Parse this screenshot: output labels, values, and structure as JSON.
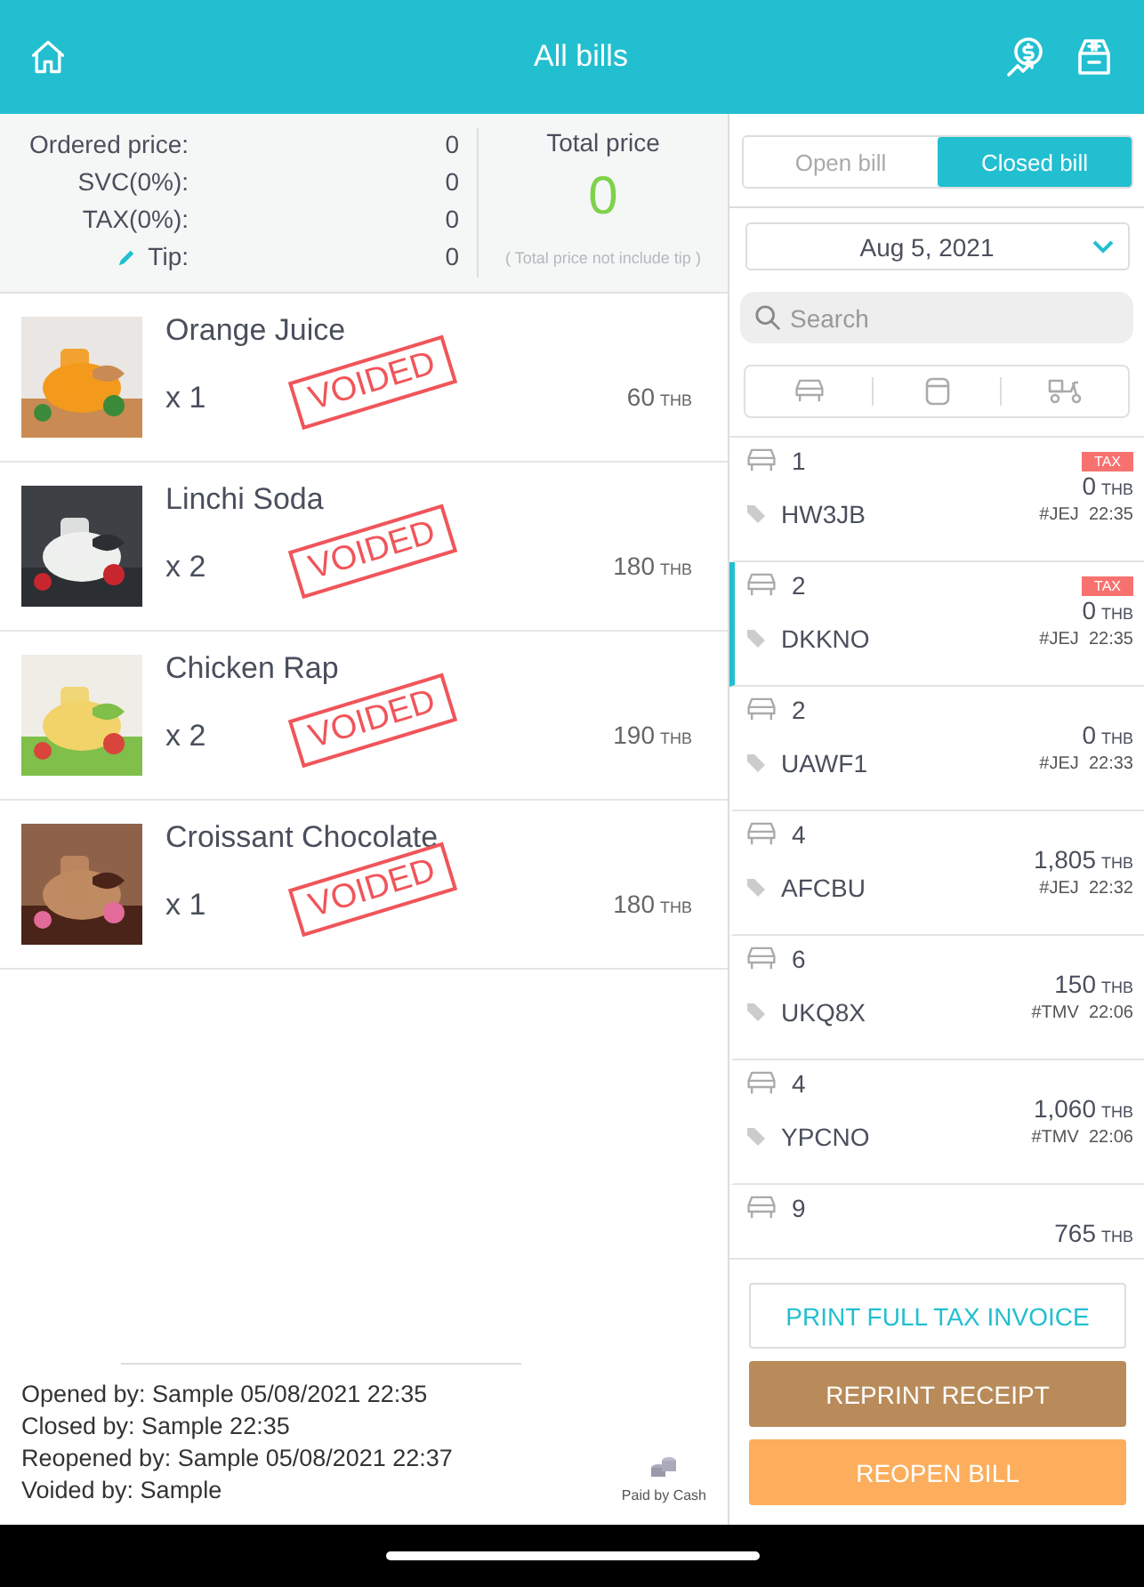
{
  "header": {
    "title": "All bills"
  },
  "summary": {
    "rows": [
      {
        "label": "Ordered price:",
        "value": "0",
        "editable": false
      },
      {
        "label": "SVC(0%):",
        "value": "0",
        "editable": false
      },
      {
        "label": "TAX(0%):",
        "value": "0",
        "editable": false
      },
      {
        "label": "Tip:",
        "value": "0",
        "editable": true
      }
    ],
    "total_label": "Total price",
    "total": "0",
    "total_note": "( Total price not include tip )"
  },
  "items": [
    {
      "name": "Orange Juice",
      "qty": "x 1",
      "price": "60",
      "currency": "THB",
      "stamp": "VOIDED"
    },
    {
      "name": "Linchi Soda",
      "qty": "x 2",
      "price": "180",
      "currency": "THB",
      "stamp": "VOIDED"
    },
    {
      "name": "Chicken Rap",
      "qty": "x 2",
      "price": "190",
      "currency": "THB",
      "stamp": "VOIDED"
    },
    {
      "name": "Croissant Chocolate",
      "qty": "x 1",
      "price": "180",
      "currency": "THB",
      "stamp": "VOIDED"
    }
  ],
  "log": [
    "Opened by: Sample 05/08/2021 22:35",
    "Closed by: Sample 22:35",
    "Reopened by: Sample 05/08/2021 22:37",
    "Voided by: Sample"
  ],
  "payment": "Paid by Cash",
  "tabs": [
    {
      "label": "Open bill",
      "selected": false
    },
    {
      "label": "Closed bill",
      "selected": true
    }
  ],
  "date": "Aug 5, 2021",
  "search": {
    "placeholder": "Search"
  },
  "bills": [
    {
      "table": "1",
      "tax": "TAX",
      "amount": "0",
      "currency": "THB",
      "code": "HW3JB",
      "tag": "#JEJ",
      "time": "22:35",
      "selected": false
    },
    {
      "table": "2",
      "tax": "TAX",
      "amount": "0",
      "currency": "THB",
      "code": "DKKNO",
      "tag": "#JEJ",
      "time": "22:35",
      "selected": true
    },
    {
      "table": "2",
      "amount": "0",
      "currency": "THB",
      "code": "UAWF1",
      "tag": "#JEJ",
      "time": "22:33",
      "selected": false
    },
    {
      "table": "4",
      "amount": "1,805",
      "currency": "THB",
      "code": "AFCBU",
      "tag": "#JEJ",
      "time": "22:32",
      "selected": false
    },
    {
      "table": "6",
      "amount": "150",
      "currency": "THB",
      "code": "UKQ8X",
      "tag": "#TMV",
      "time": "22:06",
      "selected": false
    },
    {
      "table": "4",
      "amount": "1,060",
      "currency": "THB",
      "code": "YPCNO",
      "tag": "#TMV",
      "time": "22:06",
      "selected": false
    },
    {
      "table": "9",
      "amount": "765",
      "currency": "THB",
      "selected": false
    }
  ],
  "actions": [
    {
      "label": "PRINT FULL TAX INVOICE",
      "kind": "outline"
    },
    {
      "label": "REPRINT RECEIPT",
      "kind": "brown"
    },
    {
      "label": "REOPEN BILL",
      "kind": "orange"
    }
  ]
}
